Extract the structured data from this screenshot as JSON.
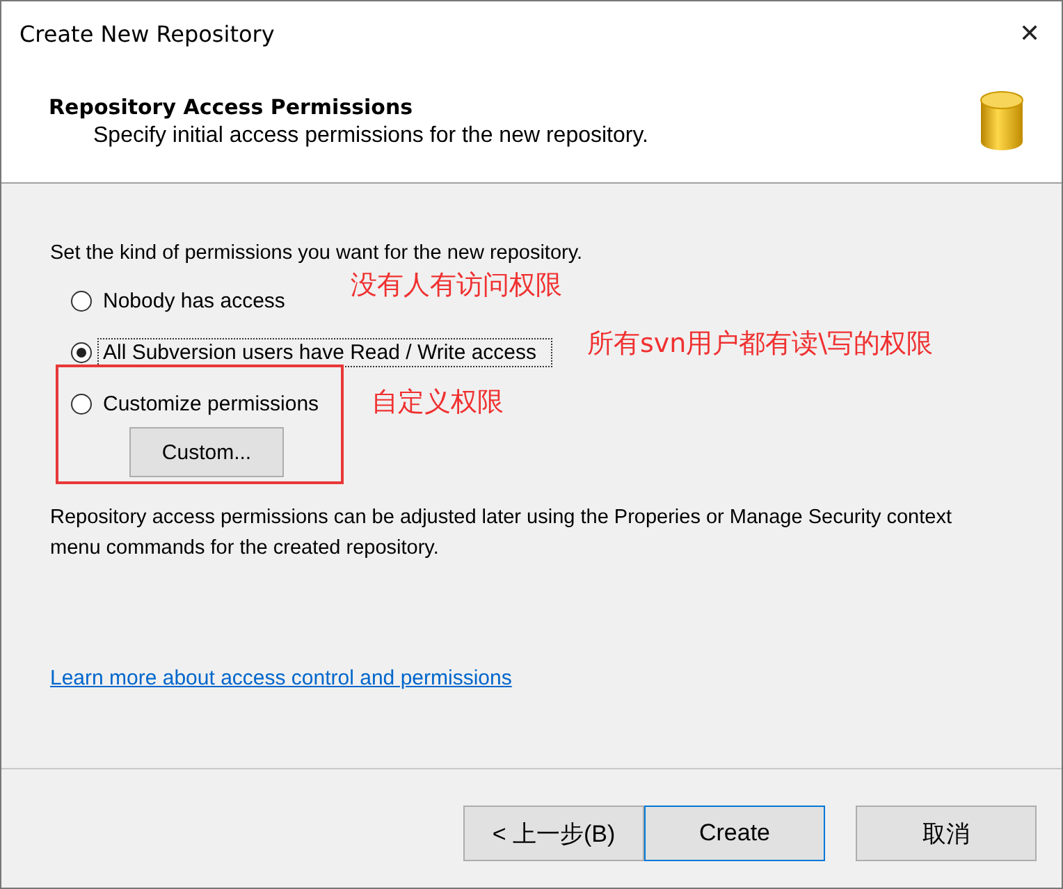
{
  "window": {
    "title": "Create New Repository",
    "close": "✕"
  },
  "header": {
    "title": "Repository Access Permissions",
    "subtitle": "Specify initial access permissions for the new repository."
  },
  "intro": "Set the kind of permissions you want for the new repository.",
  "options": [
    {
      "label": "Nobody has access",
      "selected": false,
      "focused": false
    },
    {
      "label": "All Subversion users have Read / Write access",
      "selected": true,
      "focused": true
    },
    {
      "label": "Customize permissions",
      "selected": false,
      "focused": false
    }
  ],
  "custom_button": "Custom...",
  "note": "Repository access permissions can be adjusted later using the Properies or Manage Security context menu commands for the created repository.",
  "link": "Learn more about access control and permissions",
  "annotations": [
    {
      "text": "没有人有访问权限"
    },
    {
      "text": "所有svn用户都有读\\写的权限"
    },
    {
      "text": "自定义权限"
    }
  ],
  "buttons": [
    {
      "label": "< 上一步(B)",
      "default": false
    },
    {
      "label": "Create",
      "default": true
    },
    {
      "label": "取消",
      "default": false
    }
  ]
}
